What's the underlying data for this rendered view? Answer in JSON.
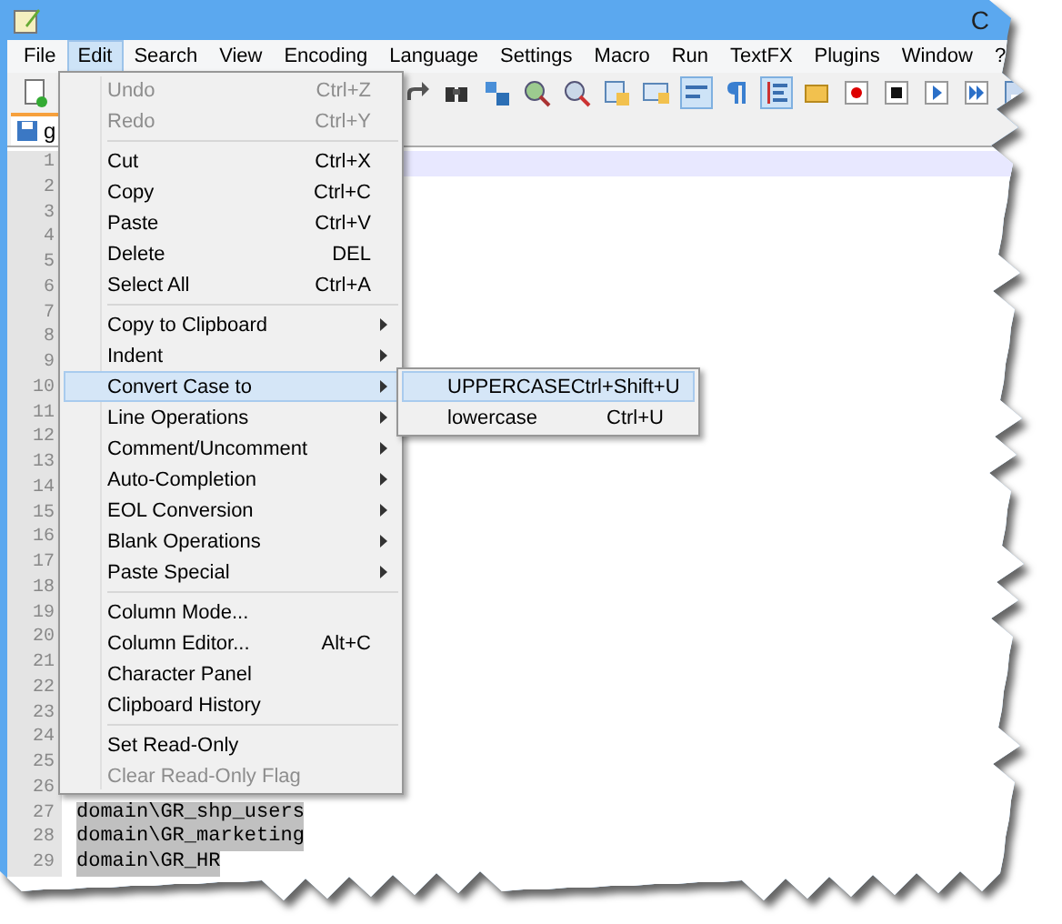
{
  "window": {
    "title": "C"
  },
  "menu_bar": [
    {
      "label": "File",
      "selected": false
    },
    {
      "label": "Edit",
      "selected": true
    },
    {
      "label": "Search",
      "selected": false
    },
    {
      "label": "View",
      "selected": false
    },
    {
      "label": "Encoding",
      "selected": false
    },
    {
      "label": "Language",
      "selected": false
    },
    {
      "label": "Settings",
      "selected": false
    },
    {
      "label": "Macro",
      "selected": false
    },
    {
      "label": "Run",
      "selected": false
    },
    {
      "label": "TextFX",
      "selected": false
    },
    {
      "label": "Plugins",
      "selected": false
    },
    {
      "label": "Window",
      "selected": false
    },
    {
      "label": "?",
      "selected": false
    }
  ],
  "toolbar": [
    {
      "kind": "new",
      "pressed": false
    },
    {
      "kind": "redo",
      "pressed": false
    },
    {
      "kind": "find",
      "pressed": false
    },
    {
      "kind": "replace",
      "pressed": false
    },
    {
      "kind": "zoom-in",
      "pressed": false
    },
    {
      "kind": "zoom-out",
      "pressed": false
    },
    {
      "kind": "sync-v",
      "pressed": false
    },
    {
      "kind": "sync-h",
      "pressed": false
    },
    {
      "kind": "wrap",
      "pressed": true
    },
    {
      "kind": "pilcrow",
      "pressed": false
    },
    {
      "kind": "indent-guide",
      "pressed": true
    },
    {
      "kind": "folder",
      "pressed": false
    },
    {
      "kind": "record",
      "pressed": false
    },
    {
      "kind": "stop",
      "pressed": false
    },
    {
      "kind": "play",
      "pressed": false
    },
    {
      "kind": "play-multi",
      "pressed": false
    },
    {
      "kind": "save-macro",
      "pressed": false
    }
  ],
  "tab": {
    "label": "g"
  },
  "editor": {
    "lines": [
      {
        "number": "1",
        "current": true
      },
      {
        "number": "2",
        "current": false
      },
      {
        "number": "3",
        "current": false
      },
      {
        "number": "4",
        "current": false
      },
      {
        "number": "5",
        "current": false
      },
      {
        "number": "6",
        "current": false
      },
      {
        "number": "7",
        "current": false
      },
      {
        "number": "8",
        "current": false
      },
      {
        "number": "9",
        "current": false
      },
      {
        "number": "10",
        "current": false
      },
      {
        "number": "11",
        "current": false
      },
      {
        "number": "12",
        "current": false
      },
      {
        "number": "13",
        "current": false
      },
      {
        "number": "14",
        "current": false
      },
      {
        "number": "15",
        "current": false
      },
      {
        "number": "16",
        "current": false
      },
      {
        "number": "17",
        "current": false
      },
      {
        "number": "18",
        "current": false
      },
      {
        "number": "19",
        "current": false
      },
      {
        "number": "20",
        "current": false
      },
      {
        "number": "21",
        "current": false
      },
      {
        "number": "22",
        "current": false
      },
      {
        "number": "23",
        "current": false
      },
      {
        "number": "24",
        "current": false
      },
      {
        "number": "25",
        "current": false
      },
      {
        "number": "26",
        "current": false
      },
      {
        "number": "27",
        "text": "domain\\GR_shp_users",
        "current": false,
        "selected": true
      },
      {
        "number": "28",
        "text": "domain\\GR_marketing",
        "current": false,
        "selected": true
      },
      {
        "number": "29",
        "text": "domain\\GR_HR",
        "current": false,
        "selected": true
      }
    ]
  },
  "edit_menu": [
    {
      "kind": "item",
      "label": "Undo",
      "shortcut": "Ctrl+Z",
      "disabled": true,
      "selected": false
    },
    {
      "kind": "item",
      "label": "Redo",
      "shortcut": "Ctrl+Y",
      "disabled": true,
      "selected": false
    },
    {
      "kind": "separator"
    },
    {
      "kind": "item",
      "label": "Cut",
      "shortcut": "Ctrl+X",
      "disabled": false,
      "selected": false
    },
    {
      "kind": "item",
      "label": "Copy",
      "shortcut": "Ctrl+C",
      "disabled": false,
      "selected": false
    },
    {
      "kind": "item",
      "label": "Paste",
      "shortcut": "Ctrl+V",
      "disabled": false,
      "selected": false
    },
    {
      "kind": "item",
      "label": "Delete",
      "shortcut": "DEL",
      "disabled": false,
      "selected": false
    },
    {
      "kind": "item",
      "label": "Select All",
      "shortcut": "Ctrl+A",
      "disabled": false,
      "selected": false
    },
    {
      "kind": "separator"
    },
    {
      "kind": "submenu",
      "label": "Copy to Clipboard",
      "disabled": false,
      "selected": false
    },
    {
      "kind": "submenu",
      "label": "Indent",
      "disabled": false,
      "selected": false
    },
    {
      "kind": "submenu",
      "label": "Convert Case to",
      "disabled": false,
      "selected": true
    },
    {
      "kind": "submenu",
      "label": "Line Operations",
      "disabled": false,
      "selected": false
    },
    {
      "kind": "submenu",
      "label": "Comment/Uncomment",
      "disabled": false,
      "selected": false
    },
    {
      "kind": "submenu",
      "label": "Auto-Completion",
      "disabled": false,
      "selected": false
    },
    {
      "kind": "submenu",
      "label": "EOL Conversion",
      "disabled": false,
      "selected": false
    },
    {
      "kind": "submenu",
      "label": "Blank Operations",
      "disabled": false,
      "selected": false
    },
    {
      "kind": "submenu",
      "label": "Paste Special",
      "disabled": false,
      "selected": false
    },
    {
      "kind": "separator"
    },
    {
      "kind": "item",
      "label": "Column Mode...",
      "disabled": false,
      "selected": false
    },
    {
      "kind": "item",
      "label": "Column Editor...",
      "shortcut": "Alt+C",
      "disabled": false,
      "selected": false
    },
    {
      "kind": "item",
      "label": "Character Panel",
      "disabled": false,
      "selected": false
    },
    {
      "kind": "item",
      "label": "Clipboard History",
      "disabled": false,
      "selected": false
    },
    {
      "kind": "separator"
    },
    {
      "kind": "item",
      "label": "Set Read-Only",
      "disabled": false,
      "selected": false
    },
    {
      "kind": "item",
      "label": "Clear Read-Only Flag",
      "disabled": true,
      "selected": false
    }
  ],
  "convert_case_menu": [
    {
      "label": "UPPERCASE",
      "shortcut": "Ctrl+Shift+U",
      "selected": true
    },
    {
      "label": "lowercase",
      "shortcut": "Ctrl+U",
      "selected": false
    }
  ]
}
